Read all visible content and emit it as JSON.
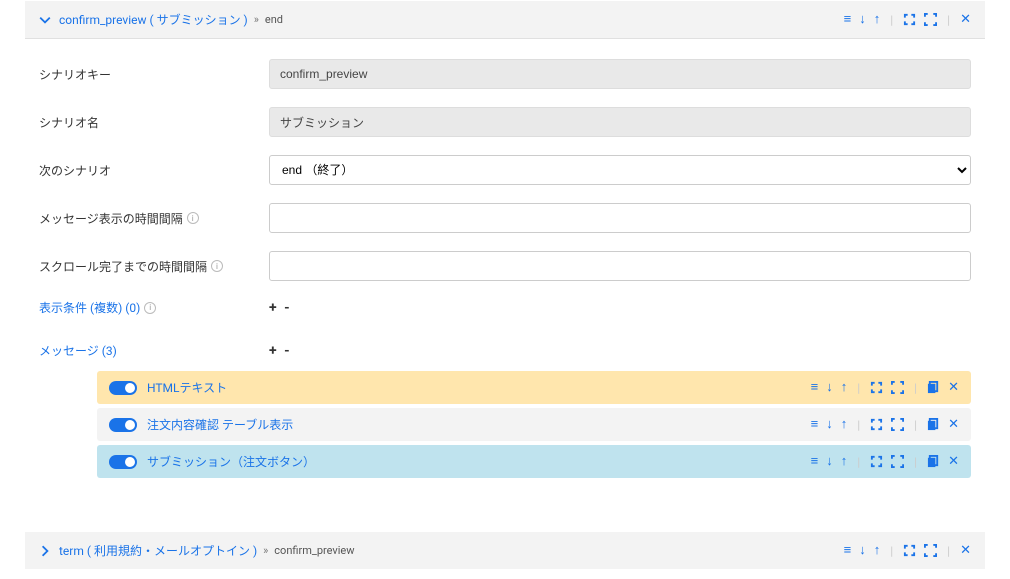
{
  "scenario": {
    "header_key": "confirm_preview",
    "header_name": "サブミッション",
    "breadcrumb_sep": "»",
    "breadcrumb_next": "end",
    "fields": {
      "key_label": "シナリオキー",
      "key_value": "confirm_preview",
      "name_label": "シナリオ名",
      "name_value": "サブミッション",
      "next_label": "次のシナリオ",
      "next_value": "end （終了）",
      "msg_interval_label": "メッセージ表示の時間間隔",
      "msg_interval_value": "",
      "scroll_interval_label": "スクロール完了までの時間間隔",
      "scroll_interval_value": ""
    },
    "conditions": {
      "label": "表示条件 (複数) (0)",
      "controls": "+ -"
    },
    "messages": {
      "label": "メッセージ (3)",
      "controls": "+ -",
      "items": [
        {
          "title": "HTMLテキスト",
          "state": "selected"
        },
        {
          "title": "注文内容確認 テーブル表示",
          "state": "normal"
        },
        {
          "title": "サブミッション（注文ボタン）",
          "state": "active"
        }
      ]
    }
  },
  "collapsed": {
    "header_key": "term",
    "header_name": "利用規約・メールオプトイン",
    "breadcrumb_next": "confirm_preview"
  }
}
